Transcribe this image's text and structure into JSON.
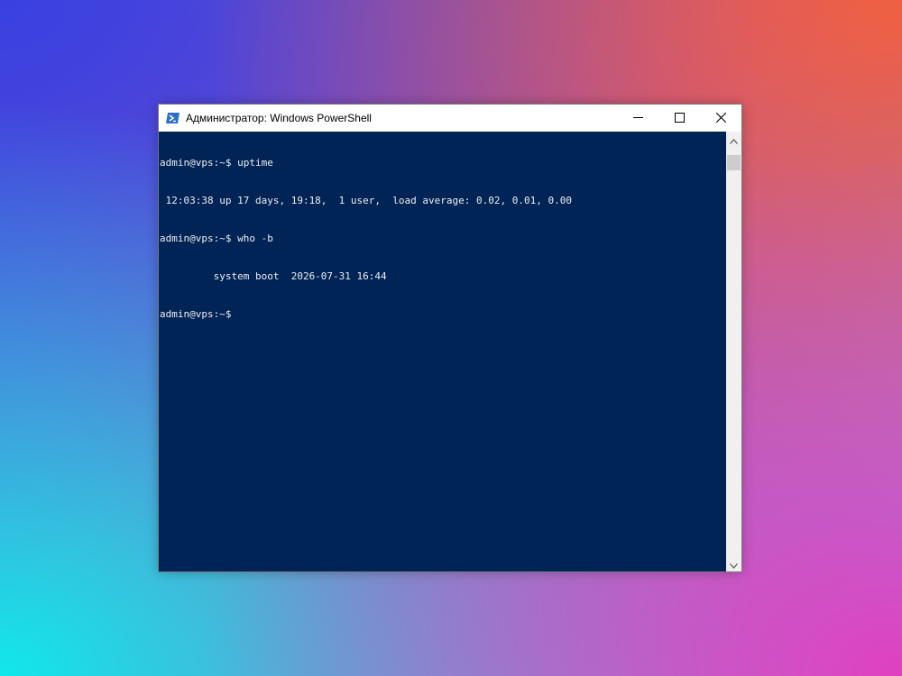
{
  "window": {
    "title": "Администратор: Windows PowerShell"
  },
  "terminal": {
    "lines": [
      "admin@vps:~$ uptime",
      " 12:03:38 up 17 days, 19:18,  1 user,  load average: 0.02, 0.01, 0.00",
      "admin@vps:~$ who -b",
      "         system boot  2026-07-31 16:44",
      "admin@vps:~$"
    ],
    "background_color": "#012456",
    "text_color": "#eeedf0"
  },
  "icons": {
    "app": "powershell-icon",
    "minimize": "minimize-icon",
    "maximize": "maximize-icon",
    "close": "close-icon",
    "scroll_up": "scroll-up-arrow-icon",
    "scroll_down": "scroll-down-arrow-icon"
  }
}
